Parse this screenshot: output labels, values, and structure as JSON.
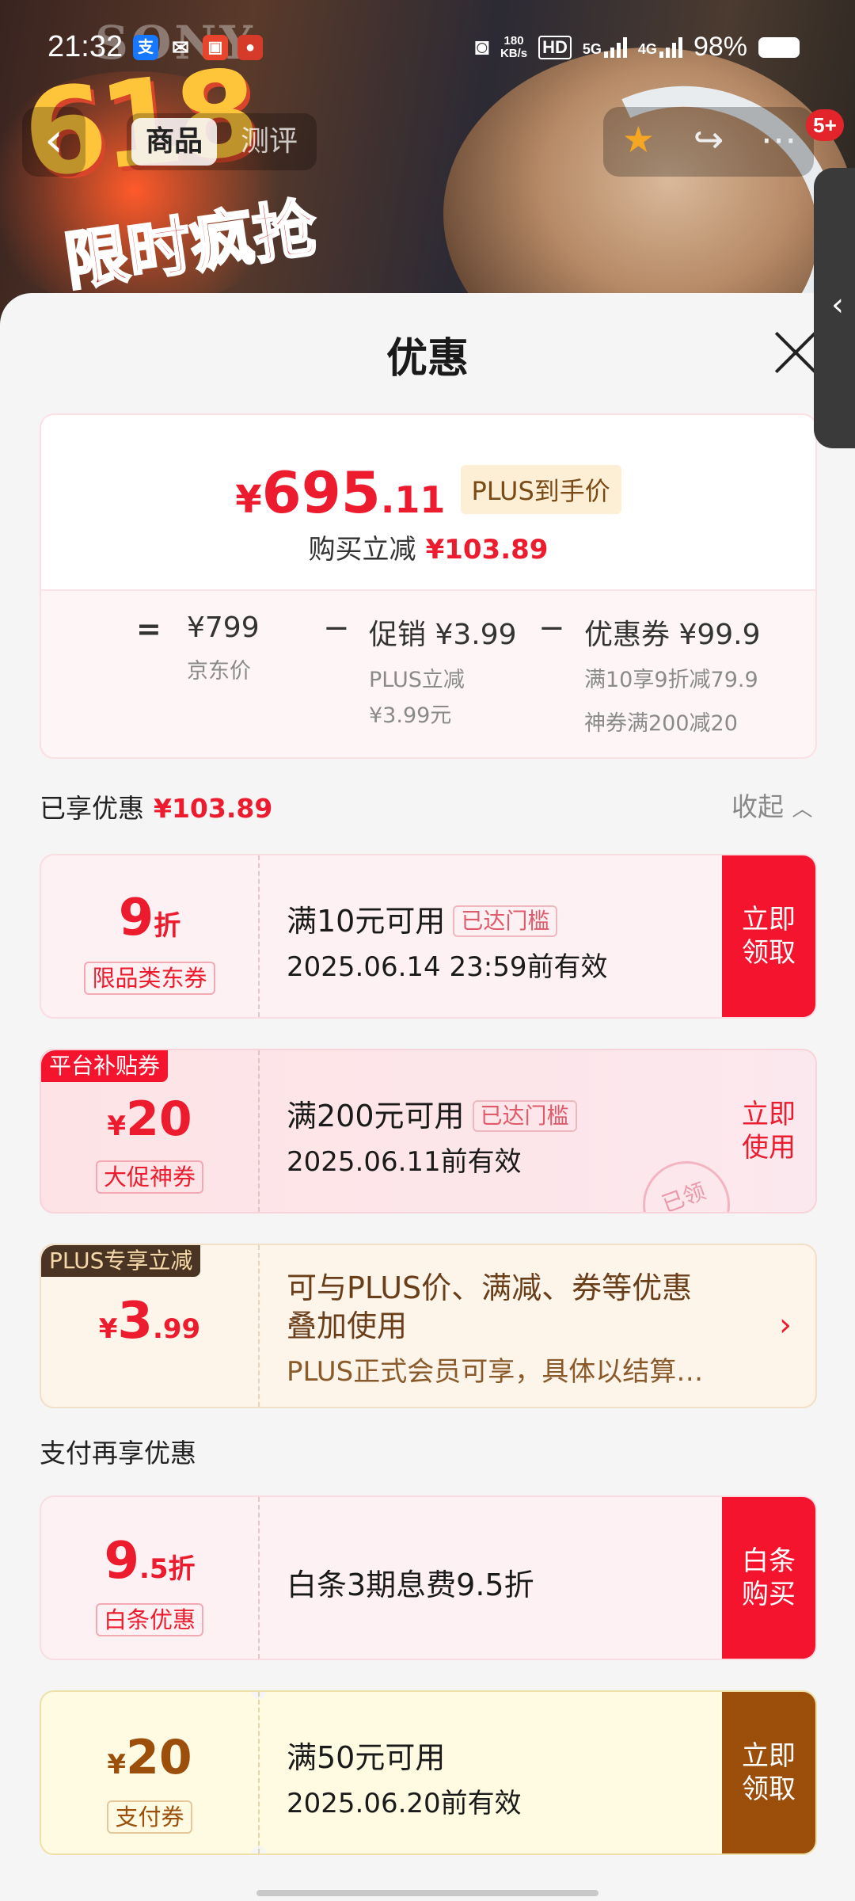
{
  "status_bar": {
    "time": "21:32",
    "net_speed_value": "180",
    "net_speed_unit": "KB/s",
    "hd": "HD",
    "net1": "5G",
    "net2": "4G",
    "battery": "98%"
  },
  "banner": {
    "brand": "SONY",
    "promo_number": "618",
    "promo_text": "限时疯抢"
  },
  "nav": {
    "tabs": [
      {
        "label": "商品",
        "active": true
      },
      {
        "label": "测评",
        "active": false
      }
    ],
    "badge": "5+"
  },
  "sheet": {
    "title": "优惠"
  },
  "summary": {
    "price_symbol": "¥",
    "price_int": "695",
    "price_dec": ".11",
    "plus_tag": "PLUS到手价",
    "reduce_label": "购买立减",
    "reduce_amount": "¥103.89",
    "eq": "=",
    "minus": "−",
    "jd_price": "¥799",
    "jd_price_label": "京东价",
    "promo_main": "促销 ¥3.99",
    "promo_sub1": "PLUS立减",
    "promo_sub2": "¥3.99元",
    "coupon_main": "优惠券 ¥99.9",
    "coupon_sub1": "满10享9折减79.9",
    "coupon_sub2": "神券满200减20"
  },
  "enjoyed": {
    "label": "已享优惠",
    "amount": "¥103.89",
    "collapse": "收起"
  },
  "coupons": [
    {
      "value": "9",
      "unit": "折",
      "label": "限品类东券",
      "line1": "满10元可用",
      "reached": "已达门槛",
      "line2": "2025.06.14 23:59前有效",
      "action": "立即领取"
    },
    {
      "tag": "平台补贴券",
      "symbol": "¥",
      "value": "20",
      "label": "大促神券",
      "line1": "满200元可用",
      "reached": "已达门槛",
      "line2": "2025.06.11前有效",
      "action": "立即使用",
      "stamp": "已领"
    },
    {
      "tag": "PLUS专享立减",
      "symbol": "¥",
      "value": "3",
      "dec": ".99",
      "line1": "可与PLUS价、满减、券等优惠",
      "line1b": "叠加使用",
      "line2": "PLUS正式会员可享，具体以结算…"
    }
  ],
  "pay_section": {
    "label": "支付再享优惠"
  },
  "pay_coupons": [
    {
      "value": "9",
      "dec": ".5",
      "unit": "折",
      "label": "白条优惠",
      "line1": "白条3期息费9.5折",
      "action": "白条购买"
    },
    {
      "symbol": "¥",
      "value": "20",
      "label": "支付券",
      "line1": "满50元可用",
      "line2": "2025.06.20前有效",
      "action": "立即领取"
    }
  ],
  "colors": {
    "accent_red": "#ec1c2e",
    "action_red": "#f5142e",
    "action_brown": "#9b4f0b",
    "plus_tag_bg": "#fdefd6"
  }
}
